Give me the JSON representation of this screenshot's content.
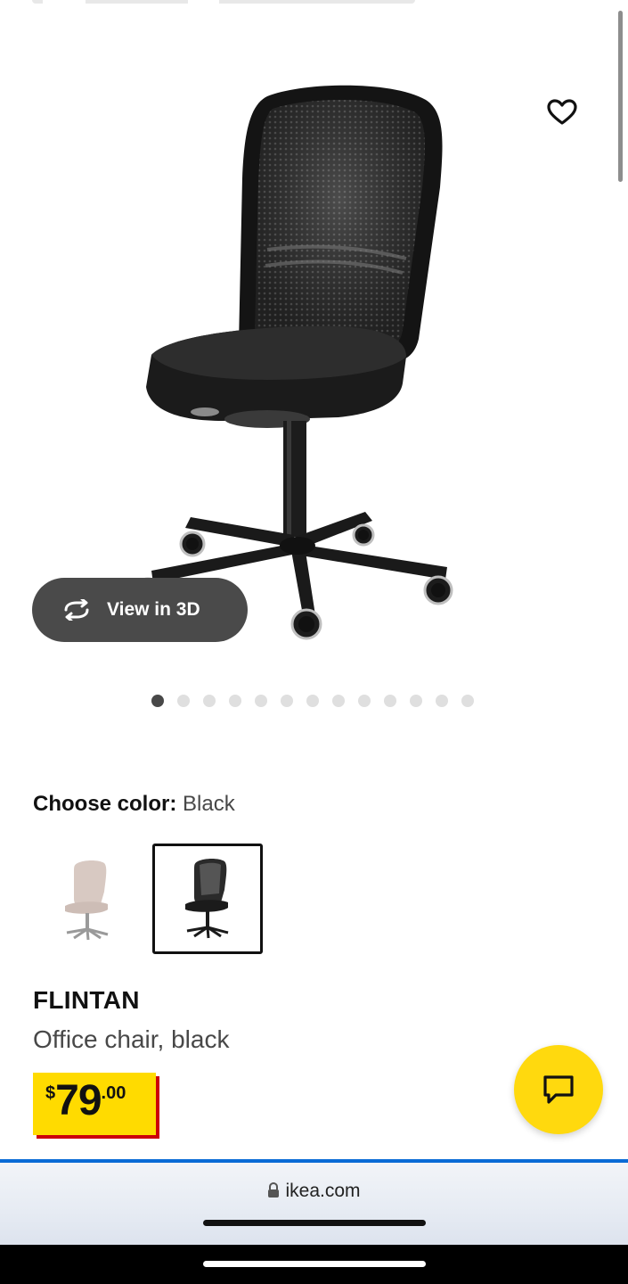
{
  "product_image": {
    "icon": "office-chair-black"
  },
  "favorite": {
    "icon": "heart-icon"
  },
  "view3d": {
    "label": "View in 3D",
    "icon": "rotate-icon"
  },
  "carousel": {
    "count": 13,
    "active_index": 0
  },
  "color": {
    "label": "Choose color:",
    "selected": "Black",
    "swatches": [
      {
        "name": "beige",
        "icon": "office-chair-beige",
        "selected": false
      },
      {
        "name": "black",
        "icon": "office-chair-black",
        "selected": true
      }
    ]
  },
  "product": {
    "name": "FLINTAN",
    "description": "Office chair, black"
  },
  "price": {
    "currency": "$",
    "integer": "79",
    "decimal": ".00",
    "tag_color": "#ffdb00",
    "shadow_color": "#cc0008"
  },
  "chat": {
    "icon": "chat-icon",
    "color": "#ffd90e"
  },
  "browser": {
    "url": "ikea.com",
    "icon": "lock-icon"
  }
}
